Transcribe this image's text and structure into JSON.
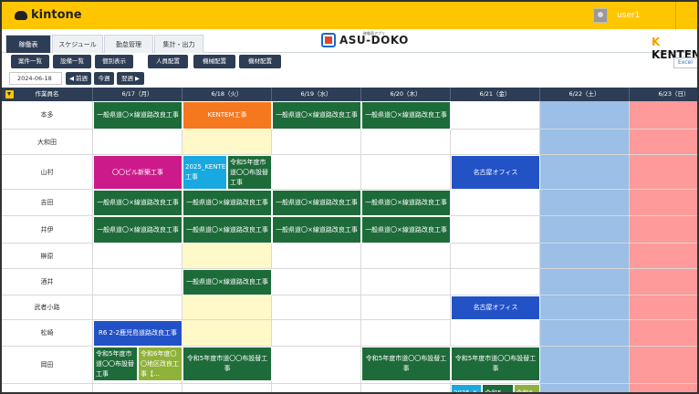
{
  "app": {
    "logo": "kintone",
    "user": "user1"
  },
  "tabs": [
    {
      "label": "稼働表",
      "active": true
    },
    {
      "label": "スケジュール",
      "active": false
    },
    {
      "label": "勤怠管理",
      "active": false
    },
    {
      "label": "集計・出力",
      "active": false
    }
  ],
  "brand": {
    "name": "ASU-DOKO",
    "sub": "稼働表アプリ",
    "partner": "KENTEM"
  },
  "toolbar": {
    "buttons": [
      "案件一覧",
      "設備一覧",
      "個別表示",
      "人員配置",
      "機械配置",
      "機材配置"
    ],
    "excel": "Excel"
  },
  "nav": {
    "date": "2024-06-18",
    "prev": "◀ 前週",
    "this": "今週",
    "next": "翌週 ▶"
  },
  "table": {
    "name_header": "作業員名",
    "days": [
      "6/17（月）",
      "6/18（火）",
      "6/19（水）",
      "6/20（木）",
      "6/21（金）",
      "6/22（土）",
      "6/23（日）"
    ],
    "workers": [
      "本多",
      "大和田",
      "山村",
      "吉田",
      "井伊",
      "榊原",
      "酒井",
      "武者小路",
      "松崎",
      "岡田",
      ""
    ],
    "events": [
      {
        "text": "一般県道〇×線道路改良工事"
      },
      {
        "text": "KENTEM工事"
      },
      {
        "text": "一般県道〇×線道路改良工事"
      },
      {
        "text": "一般県道〇×線道路改良工事"
      },
      {
        "text": "〇〇ビル新築工事"
      },
      {
        "text": "2025_KENTEM 工事"
      },
      {
        "text": "令和5年度市道〇〇布設替工事"
      },
      {
        "text": "名古屋オフィス"
      },
      {
        "text": "一般県道〇×線道路改良工事"
      },
      {
        "text": "一般県道〇×線道路改良工事"
      },
      {
        "text": "一般県道〇×線道路改良工事"
      },
      {
        "text": "一般県道〇×線道路改良工事"
      },
      {
        "text": "一般県道〇×線道路改良工事"
      },
      {
        "text": "一般県道〇×線道路改良工事"
      },
      {
        "text": "一般県道〇×線道路改良工事"
      },
      {
        "text": "一般県道〇×線道路改良工事"
      },
      {
        "text": "一般県道〇×線道路改良工事"
      },
      {
        "text": "名古屋オフィス"
      },
      {
        "text": "R6 2-2鹿児島道路改良工事"
      },
      {
        "text": "令和5年度市道〇〇布設替工事"
      },
      {
        "text": "令和6年度〇〇地区改良工事【…"
      },
      {
        "text": "令和5年度市道〇〇布設替工事"
      },
      {
        "text": "令和5年度市道〇〇布設替工事"
      },
      {
        "text": "令和5年度市道〇〇布設替工事"
      },
      {
        "text": "2025_K"
      },
      {
        "text": "令和5"
      },
      {
        "text": "令和6"
      }
    ]
  },
  "colors": {
    "green": "#1e6b3a",
    "orange": "#f5781e",
    "magenta": "#cc1a8a",
    "cyan": "#19a9e1",
    "blue": "#2352c6",
    "olive": "#8fb23a",
    "sat": "#9bbfe6",
    "sun": "#ff9a9a",
    "yellow": "#fff8c8",
    "header": "#2d3d55"
  }
}
